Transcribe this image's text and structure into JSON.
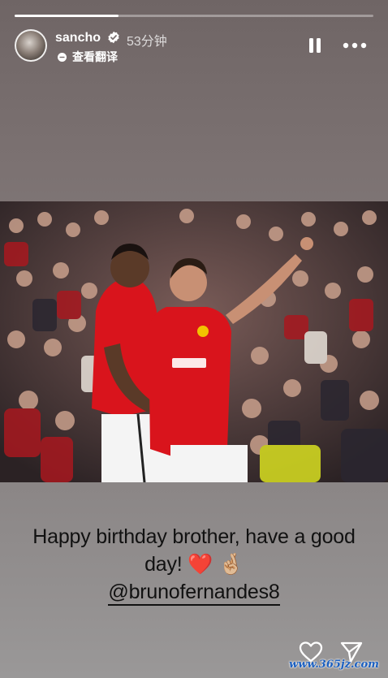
{
  "story": {
    "progress": 0.29,
    "username": "sancho",
    "timestamp": "53分钟",
    "translate_label": "查看翻译"
  },
  "caption": {
    "line1": "Happy birthday brother, have a good",
    "line2": "day!",
    "emoji_heart": "❤️",
    "emoji_fingers": "🤞🏼",
    "mention": "@brunofernandes8"
  },
  "watermark": "www.365jz.com",
  "colors": {
    "accent": "#ffffff",
    "verified": "#ffffff",
    "jersey_red": "#d9141c",
    "caption_text": "#111111",
    "watermark": "#1a5fc0"
  },
  "icons": {
    "verified": "verified-badge-icon",
    "translate": "translate-dot-icon",
    "pause": "pause-icon",
    "more": "more-horizontal-icon",
    "like": "heart-outline-icon",
    "send": "paper-plane-icon"
  }
}
